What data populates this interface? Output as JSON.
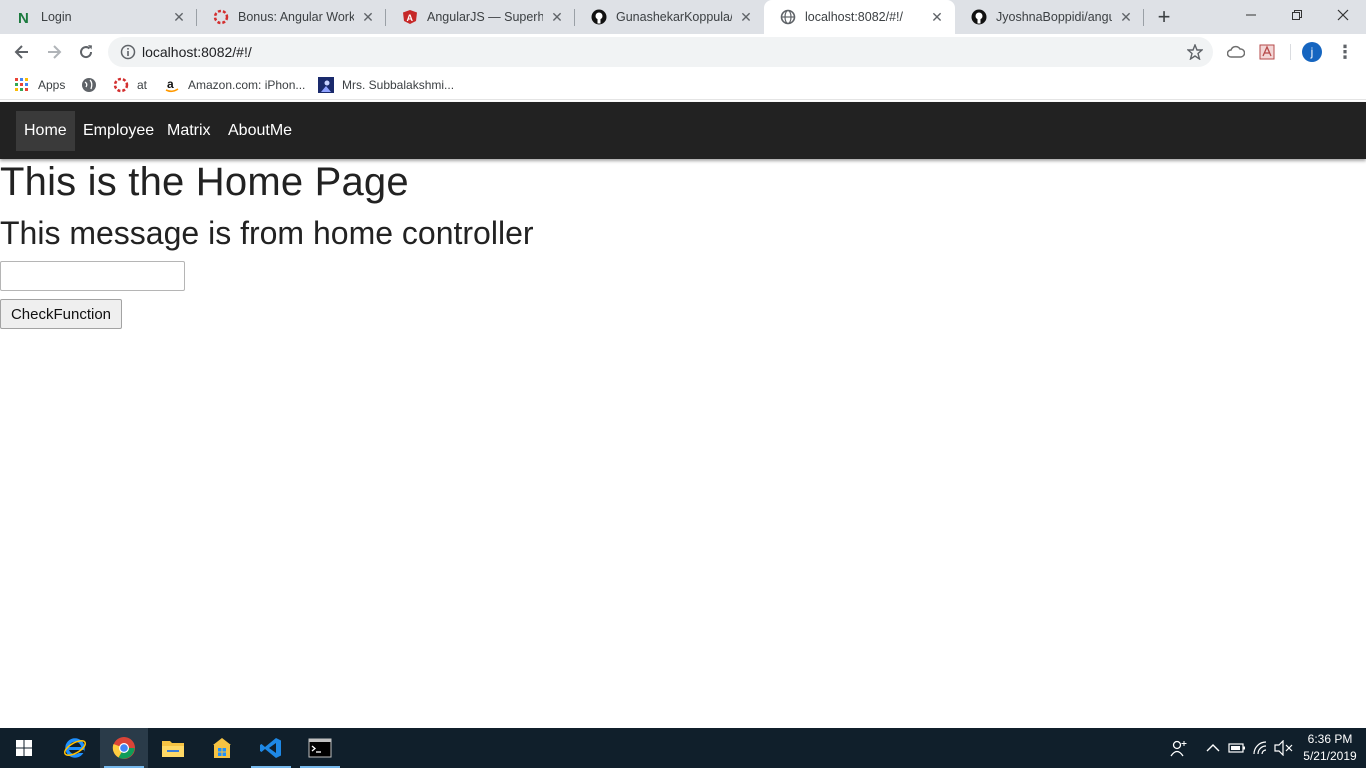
{
  "browser": {
    "tabs": [
      {
        "title": "Login",
        "icon": "n-logo-icon",
        "active": false
      },
      {
        "title": "Bonus: Angular Worksh",
        "icon": "spinner-icon",
        "active": false
      },
      {
        "title": "AngularJS — Superhero",
        "icon": "angular-icon",
        "active": false
      },
      {
        "title": "GunashekarKoppula/an",
        "icon": "github-icon",
        "active": false
      },
      {
        "title": "localhost:8082/#!/",
        "icon": "globe-icon",
        "active": true
      },
      {
        "title": "JyoshnaBoppidi/angula",
        "icon": "github-icon",
        "active": false
      }
    ],
    "address": "localhost:8082/#!/",
    "profile_initial": "j",
    "bookmarks": [
      {
        "label": "Apps",
        "icon": "apps-grid-icon"
      },
      {
        "label": "",
        "icon": "globe-icon"
      },
      {
        "label": "at",
        "icon": "spinner-icon"
      },
      {
        "label": "Amazon.com: iPhon...",
        "icon": "amazon-icon"
      },
      {
        "label": "Mrs. Subbalakshmi...",
        "icon": "image-icon"
      }
    ]
  },
  "nav": {
    "items": [
      "Home",
      "Employee",
      "Matrix",
      "AboutMe"
    ],
    "active": "Home"
  },
  "page": {
    "title": "This is the Home Page",
    "message": "This message is from home controller",
    "input_value": "",
    "button_label": "CheckFunction"
  },
  "taskbar": {
    "time": "6:36 PM",
    "date": "5/21/2019"
  },
  "colors": {
    "navbar_bg": "#222222",
    "taskbar_bg": "#101f2b",
    "tabstrip_bg": "#dee1e6"
  }
}
